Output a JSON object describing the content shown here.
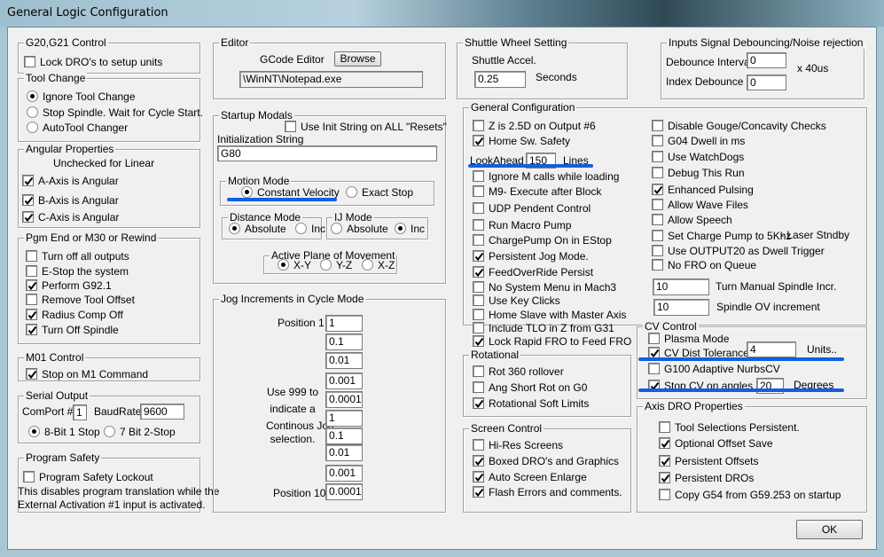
{
  "window": {
    "title": "General Logic Configuration"
  },
  "g20": {
    "title": "G20,G21 Control",
    "lock": {
      "label": "Lock DRO's to setup units",
      "checked": false
    }
  },
  "tool_change": {
    "title": "Tool Change",
    "options": [
      {
        "label": "Ignore Tool Change",
        "selected": true
      },
      {
        "label": "Stop Spindle. Wait for Cycle Start.",
        "selected": false
      },
      {
        "label": "AutoTool Changer",
        "selected": false
      }
    ]
  },
  "angular": {
    "title": "Angular Properties",
    "note": "Unchecked for Linear",
    "items": [
      {
        "label": "A-Axis is Angular",
        "checked": true
      },
      {
        "label": "B-Axis is Angular",
        "checked": true
      },
      {
        "label": "C-Axis is Angular",
        "checked": true
      }
    ]
  },
  "pgm_end": {
    "title": "Pgm End or M30 or Rewind",
    "items": [
      {
        "label": "Turn off all outputs",
        "checked": false
      },
      {
        "label": "E-Stop the system",
        "checked": false
      },
      {
        "label": "Perform G92.1",
        "checked": true
      },
      {
        "label": "Remove Tool Offset",
        "checked": false
      },
      {
        "label": "Radius Comp Off",
        "checked": true
      },
      {
        "label": "Turn Off Spindle",
        "checked": true
      }
    ]
  },
  "m01": {
    "title": "M01 Control",
    "items": [
      {
        "label": "Stop on M1 Command",
        "checked": true
      }
    ]
  },
  "serial": {
    "title": "Serial Output",
    "comport_label": "ComPort #",
    "comport": "1",
    "baud_label": "BaudRate",
    "baud": "9600",
    "options": [
      {
        "label": "8-Bit 1 Stop",
        "selected": true
      },
      {
        "label": "7 Bit 2-Stop",
        "selected": false
      }
    ]
  },
  "safety": {
    "title": "Program Safety",
    "items": [
      {
        "label": "Program Safety Lockout",
        "checked": false
      }
    ],
    "note1": "This disables program translation while the",
    "note2": "External Activation #1 input is activated."
  },
  "editor": {
    "title": "Editor",
    "label": "GCode Editor",
    "browse": "Browse",
    "path": "\\WinNT\\Notepad.exe"
  },
  "startup": {
    "title": "Startup Modals",
    "use_init": {
      "label": "Use Init String on ALL  \"Resets\"",
      "checked": false
    },
    "init_label": "Initialization String",
    "init_value": "G80",
    "motion": {
      "title": "Motion Mode",
      "options": [
        {
          "label": "Constant Velocity",
          "selected": true
        },
        {
          "label": "Exact Stop",
          "selected": false
        }
      ]
    },
    "distance": {
      "title": "Distance Mode",
      "options": [
        {
          "label": "Absolute",
          "selected": true
        },
        {
          "label": "Inc",
          "selected": false
        }
      ]
    },
    "ij": {
      "title": "IJ Mode",
      "options": [
        {
          "label": "Absolute",
          "selected": false
        },
        {
          "label": "Inc",
          "selected": true
        }
      ]
    },
    "plane": {
      "title": "Active Plane of Movement",
      "options": [
        {
          "label": "X-Y",
          "selected": true
        },
        {
          "label": "Y-Z",
          "selected": false
        },
        {
          "label": "X-Z",
          "selected": false
        }
      ]
    }
  },
  "jog": {
    "title": "Jog Increments in Cycle Mode",
    "first_label": "Position 1",
    "last_label": "Position 10",
    "note": [
      "Use 999 to",
      "indicate a",
      "Continous Jog",
      "selection."
    ],
    "values": [
      "1",
      "0.1",
      "0.01",
      "0.001",
      "0.0001",
      "1",
      "0.1",
      "0.01",
      "0.001",
      "0.0001"
    ]
  },
  "shuttle": {
    "title": "Shuttle Wheel Setting",
    "accel_label": "Shuttle Accel.",
    "accel": "0.25",
    "unit": "Seconds"
  },
  "debounce": {
    "title": "Inputs Signal Debouncing/Noise rejection",
    "interval_label": "Debounce Interval:",
    "interval": "0",
    "index_label": "Index Debounce",
    "index": "0",
    "unit": "x 40us"
  },
  "general": {
    "title": "General Configuration",
    "left": [
      {
        "label": "Z is 2.5D on Output #6",
        "checked": false
      },
      {
        "label": "Home Sw. Safety",
        "checked": true
      },
      {
        "label": "Ignore M calls while loading",
        "checked": false
      },
      {
        "label": "M9- Execute after Block",
        "checked": false
      },
      {
        "label": "UDP Pendent Control",
        "checked": false
      },
      {
        "label": "Run Macro Pump",
        "checked": false
      },
      {
        "label": "ChargePump On in EStop",
        "checked": false
      },
      {
        "label": "Persistent Jog Mode.",
        "checked": true
      },
      {
        "label": "FeedOverRide Persist",
        "checked": true
      },
      {
        "label": "No System Menu in Mach3",
        "checked": false
      },
      {
        "label": "Use Key Clicks",
        "checked": false
      },
      {
        "label": "Home Slave with Master Axis",
        "checked": false
      },
      {
        "label": "Include TLO in Z from G31",
        "checked": false
      },
      {
        "label": "Lock Rapid FRO to Feed FRO",
        "checked": true
      }
    ],
    "lookahead": {
      "label": "LookAhead",
      "value": "150",
      "unit": "Lines"
    },
    "right": [
      {
        "label": "Disable Gouge/Concavity Checks",
        "checked": false
      },
      {
        "label": "G04 Dwell in ms",
        "checked": false
      },
      {
        "label": "Use WatchDogs",
        "checked": false
      },
      {
        "label": "Debug This Run",
        "checked": false
      },
      {
        "label": "Enhanced Pulsing",
        "checked": true
      },
      {
        "label": "Allow Wave Files",
        "checked": false
      },
      {
        "label": "Allow Speech",
        "checked": false
      },
      {
        "label": "Set Charge Pump to 5Khz",
        "checked": false
      },
      {
        "label": "Use OUTPUT20 as Dwell Trigger",
        "checked": false
      },
      {
        "label": "No FRO on Queue",
        "checked": false
      }
    ],
    "laser_note": "- Laser Stndby",
    "spindle_incr": {
      "value": "10",
      "label": "Turn Manual Spindle Incr."
    },
    "spindle_ov": {
      "value": "10",
      "label": "Spindle OV increment"
    }
  },
  "rotational": {
    "title": "Rotational",
    "items": [
      {
        "label": "Rot 360 rollover",
        "checked": false
      },
      {
        "label": "Ang Short Rot on G0",
        "checked": false
      },
      {
        "label": "Rotational Soft Limits",
        "checked": true
      }
    ]
  },
  "screen": {
    "title": "Screen Control",
    "items": [
      {
        "label": "Hi-Res Screens",
        "checked": false
      },
      {
        "label": "Boxed DRO's and Graphics",
        "checked": true
      },
      {
        "label": "Auto Screen Enlarge",
        "checked": true
      },
      {
        "label": "Flash Errors and comments.",
        "checked": true
      }
    ]
  },
  "cv": {
    "title": "CV Control",
    "plasma": {
      "label": "Plasma Mode",
      "checked": false
    },
    "dist": {
      "label": "CV Dist Tolerance",
      "checked": true,
      "value": "4",
      "unit": "Units.."
    },
    "g100": {
      "label": "G100 Adaptive NurbsCV",
      "checked": false
    },
    "stop": {
      "label": "Stop CV on angles >",
      "checked": true,
      "value": "20",
      "unit": "Degrees"
    }
  },
  "axis_dro": {
    "title": "Axis DRO Properties",
    "items": [
      {
        "label": "Tool Selections Persistent.",
        "checked": false
      },
      {
        "label": "Optional Offset Save",
        "checked": true
      },
      {
        "label": "Persistent Offsets",
        "checked": true
      },
      {
        "label": "Persistent DROs",
        "checked": true
      },
      {
        "label": "Copy G54 from G59.253 on startup",
        "checked": false
      }
    ]
  },
  "ok_label": "OK"
}
